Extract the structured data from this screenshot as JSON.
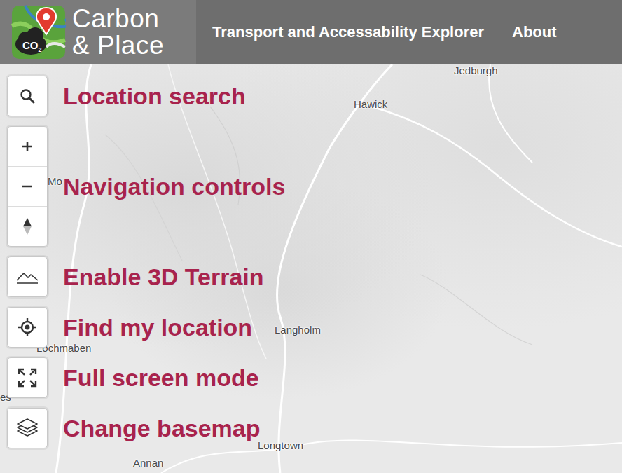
{
  "header": {
    "logo": {
      "badge": "CO",
      "badge_sub": "2",
      "line1": "Carbon",
      "line2": "& Place"
    },
    "nav": [
      {
        "label": "Transport and Accessability Explorer"
      },
      {
        "label": "About"
      }
    ]
  },
  "controls": [
    {
      "kind": "search",
      "annotation": "Location search"
    },
    {
      "kind": "navigation",
      "annotation": "Navigation controls"
    },
    {
      "kind": "terrain",
      "annotation": "Enable 3D Terrain"
    },
    {
      "kind": "locate",
      "annotation": "Find my location"
    },
    {
      "kind": "fullscreen",
      "annotation": "Full screen mode"
    },
    {
      "kind": "basemap",
      "annotation": "Change basemap"
    }
  ],
  "map": {
    "places": [
      {
        "name": "Jedburgh"
      },
      {
        "name": "Hawick"
      },
      {
        "name": "Mo"
      },
      {
        "name": "Langholm"
      },
      {
        "name": "Lochmaben"
      },
      {
        "name": "es"
      },
      {
        "name": "Longtown"
      },
      {
        "name": "Annan"
      }
    ]
  }
}
